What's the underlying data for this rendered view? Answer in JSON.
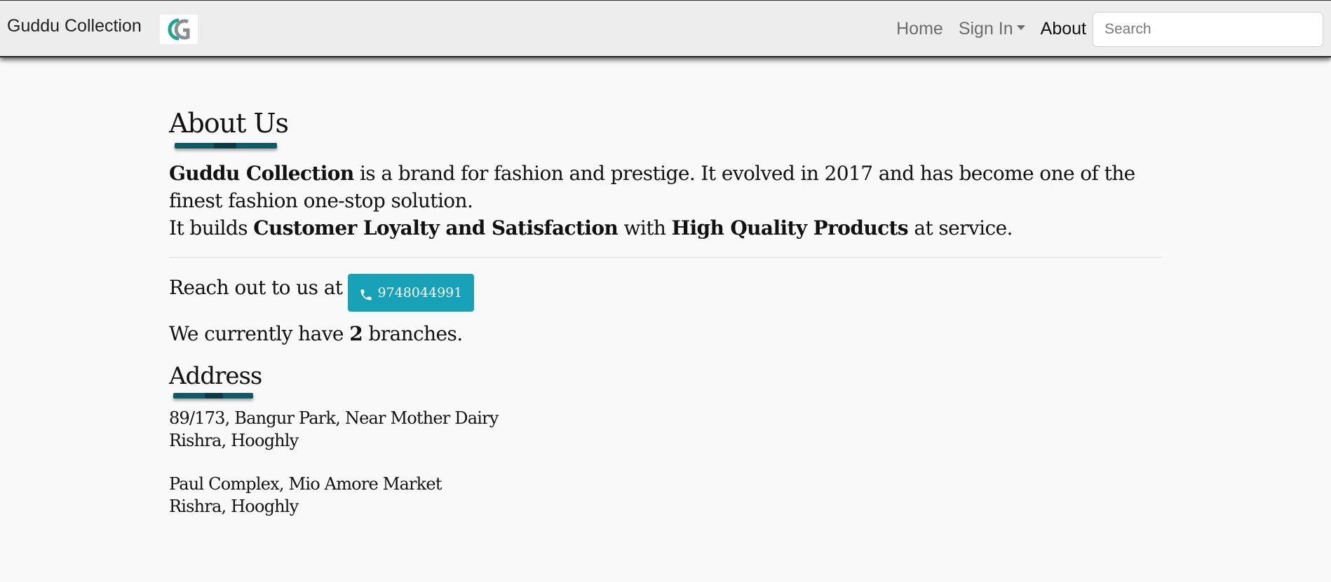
{
  "navbar": {
    "brand": "Guddu Collection",
    "logo_icon": "gc-logo-icon",
    "links": {
      "home": "Home",
      "sign_in": "Sign In",
      "about": "About"
    },
    "search_placeholder": "Search"
  },
  "about": {
    "title": "About Us",
    "intro": {
      "brand": "Guddu Collection",
      "text1": " is a brand for fashion and prestige. It evolved in 2017 and has become one of the finest fashion one-stop solution.",
      "text2": "It builds ",
      "bold1": "Customer Loyalty and Satisfaction",
      "text3": " with ",
      "bold2": "High Quality Products",
      "text4": " at service."
    },
    "reach_text": "Reach out to us at",
    "phone": "9748044991",
    "branches_pre": "We currently have ",
    "branches_count": "2",
    "branches_post": " branches."
  },
  "address": {
    "title": "Address",
    "branches": [
      {
        "line1": "89/173, Bangur Park, Near Mother Dairy",
        "line2": "Rishra, Hooghly"
      },
      {
        "line1": "Paul Complex, Mio Amore Market",
        "line2": "Rishra, Hooghly"
      }
    ]
  },
  "colors": {
    "accent": "#17a2b8",
    "underline": "#0f5a66",
    "navbar_bg": "#ededed"
  }
}
